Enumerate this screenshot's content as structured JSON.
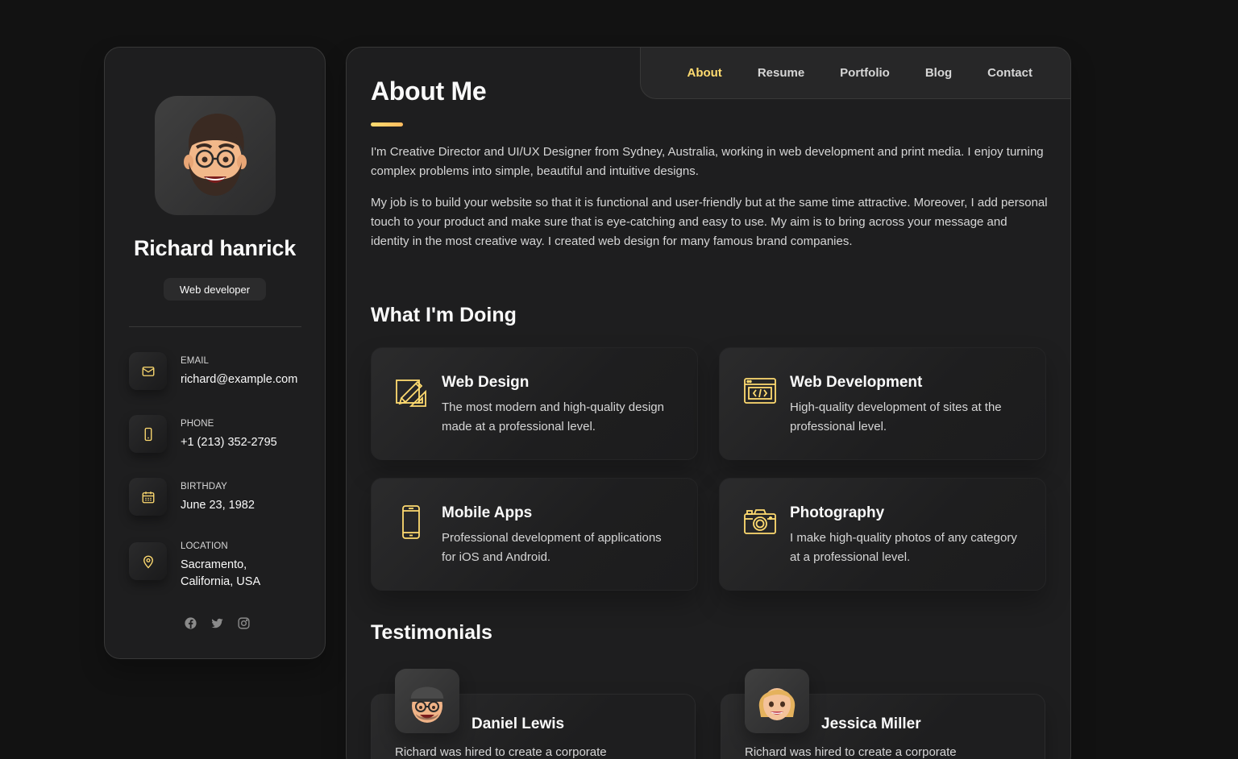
{
  "sidebar": {
    "name": "Richard hanrick",
    "title": "Web developer",
    "contacts": [
      {
        "label": "Email",
        "value": "richard@example.com",
        "icon": "mail-icon"
      },
      {
        "label": "Phone",
        "value": "+1 (213) 352-2795",
        "icon": "phone-icon"
      },
      {
        "label": "Birthday",
        "value": "June 23, 1982",
        "icon": "calendar-icon"
      },
      {
        "label": "Location",
        "value": "Sacramento, California, USA",
        "icon": "location-icon"
      }
    ],
    "socials": [
      "facebook-icon",
      "twitter-icon",
      "instagram-icon"
    ]
  },
  "nav": {
    "items": [
      "About",
      "Resume",
      "Portfolio",
      "Blog",
      "Contact"
    ],
    "active": "About"
  },
  "about": {
    "title": "About Me",
    "paragraphs": [
      "I'm Creative Director and UI/UX Designer from Sydney, Australia, working in web development and print media. I enjoy turning complex problems into simple, beautiful and intuitive designs.",
      "My job is to build your website so that it is functional and user-friendly but at the same time attractive. Moreover, I add personal touch to your product and make sure that is eye-catching and easy to use. My aim is to bring across your message and identity in the most creative way. I created web design for many famous brand companies."
    ]
  },
  "services": {
    "title": "What I'm Doing",
    "items": [
      {
        "title": "Web Design",
        "text": "The most modern and high-quality design made at a professional level.",
        "icon": "design-icon"
      },
      {
        "title": "Web Development",
        "text": "High-quality development of sites at the professional level.",
        "icon": "code-icon"
      },
      {
        "title": "Mobile Apps",
        "text": "Professional development of applications for iOS and Android.",
        "icon": "mobile-icon"
      },
      {
        "title": "Photography",
        "text": "I make high-quality photos of any category at a professional level.",
        "icon": "camera-icon"
      }
    ]
  },
  "testimonials": {
    "title": "Testimonials",
    "items": [
      {
        "name": "Daniel Lewis",
        "text": "Richard was hired to create a corporate"
      },
      {
        "name": "Jessica Miller",
        "text": "Richard was hired to create a corporate"
      }
    ]
  },
  "colors": {
    "accent": "#ffdb70",
    "background": "#121212",
    "panel": "#1e1e1f",
    "text_muted": "#d6d6d6"
  }
}
